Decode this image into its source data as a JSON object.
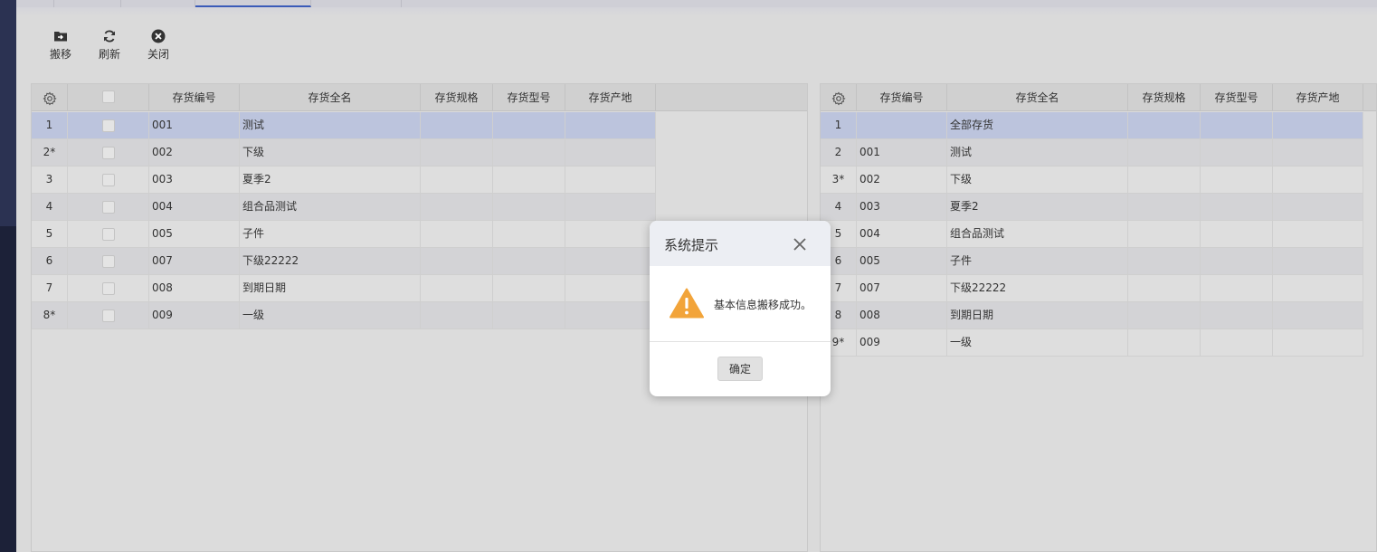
{
  "toolbar": {
    "move_label": "搬移",
    "refresh_label": "刷新",
    "close_label": "关闭"
  },
  "left_grid": {
    "columns": [
      "存货编号",
      "存货全名",
      "存货规格",
      "存货型号",
      "存货产地"
    ],
    "rows": [
      {
        "n": "1",
        "code": "001",
        "name": "测试"
      },
      {
        "n": "2*",
        "code": "002",
        "name": "下级"
      },
      {
        "n": "3",
        "code": "003",
        "name": "夏季2"
      },
      {
        "n": "4",
        "code": "004",
        "name": "组合品测试"
      },
      {
        "n": "5",
        "code": "005",
        "name": "子件"
      },
      {
        "n": "6",
        "code": "007",
        "name": "下级22222"
      },
      {
        "n": "7",
        "code": "008",
        "name": "到期日期"
      },
      {
        "n": "8*",
        "code": "009",
        "name": "一级"
      }
    ]
  },
  "right_grid": {
    "columns": [
      "存货编号",
      "存货全名",
      "存货规格",
      "存货型号",
      "存货产地"
    ],
    "rows": [
      {
        "n": "1",
        "code": "",
        "name": "全部存货"
      },
      {
        "n": "2",
        "code": "001",
        "name": "测试"
      },
      {
        "n": "3*",
        "code": "002",
        "name": "下级"
      },
      {
        "n": "4",
        "code": "003",
        "name": "夏季2"
      },
      {
        "n": "5",
        "code": "004",
        "name": "组合品测试"
      },
      {
        "n": "6",
        "code": "005",
        "name": "子件"
      },
      {
        "n": "7",
        "code": "007",
        "name": "下级22222"
      },
      {
        "n": "8",
        "code": "008",
        "name": "到期日期"
      },
      {
        "n": "9*",
        "code": "009",
        "name": "一级"
      }
    ]
  },
  "dialog": {
    "title": "系统提示",
    "message": "基本信息搬移成功。",
    "ok_label": "确定"
  },
  "colors": {
    "selected_row": "#bcc4dd",
    "active_tab": "#3b5bb8",
    "warning": "#f2a43a"
  }
}
